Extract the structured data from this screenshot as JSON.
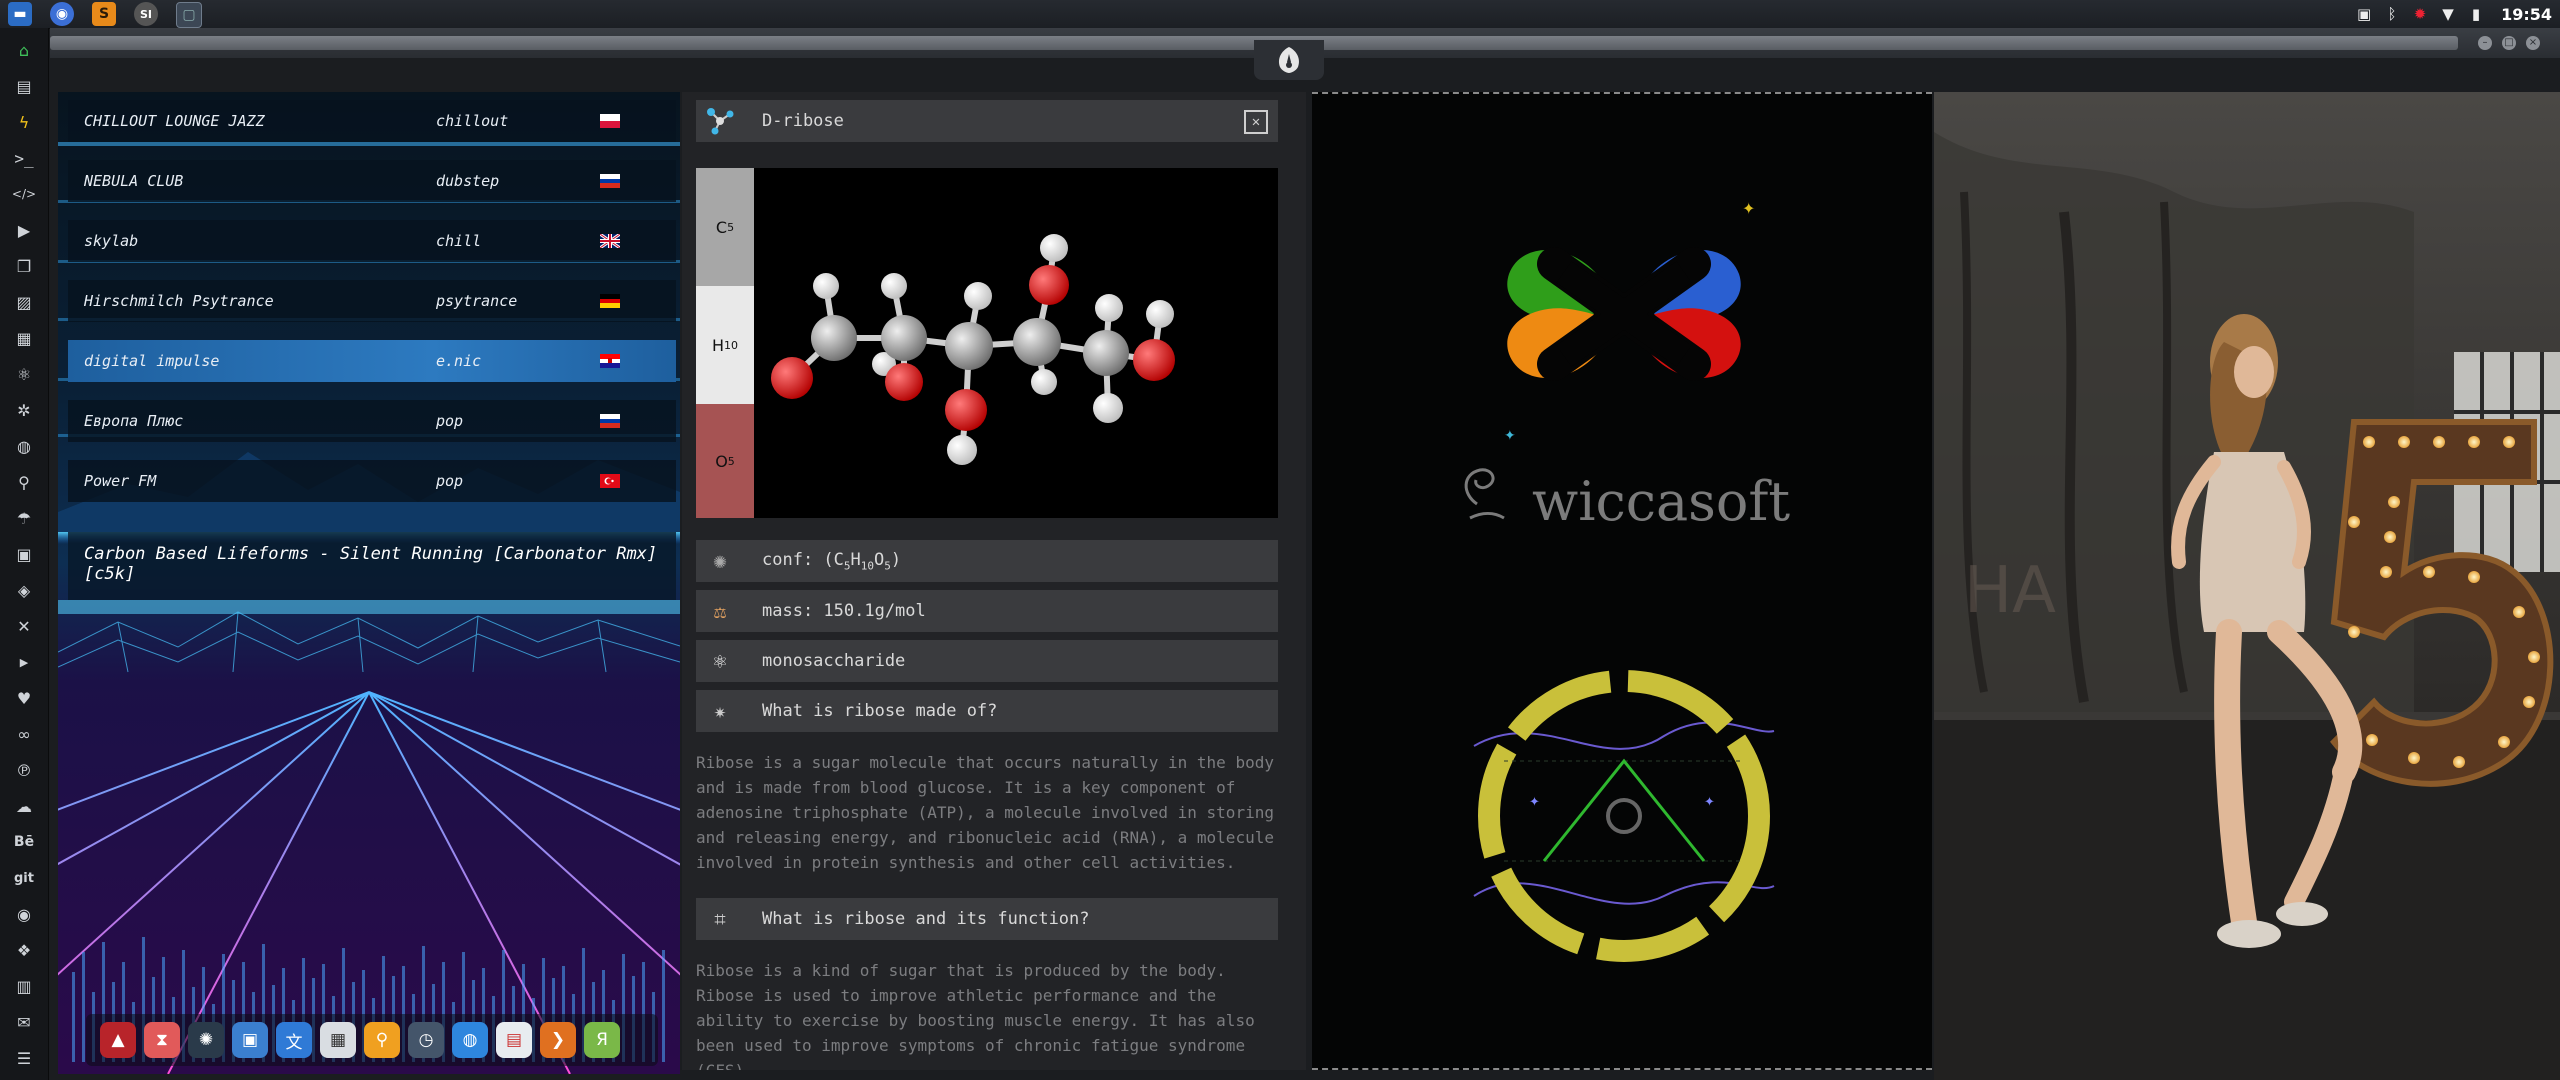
{
  "clock": "19:54",
  "radio": {
    "stations": [
      {
        "name": "CHILLOUT LOUNGE JAZZ",
        "genre": "chillout",
        "flag": "pl"
      },
      {
        "name": "NEBULA CLUB",
        "genre": "dubstep",
        "flag": "ru"
      },
      {
        "name": "skylab",
        "genre": "chill",
        "flag": "gb"
      },
      {
        "name": "Hirschmilch Psytrance",
        "genre": "psytrance",
        "flag": "de"
      },
      {
        "name": "digital impulse",
        "genre": "e.nic",
        "flag": "hr"
      },
      {
        "name": "Европа Плюс",
        "genre": "pop",
        "flag": "ru"
      },
      {
        "name": "Power FM",
        "genre": "pop",
        "flag": "tr"
      }
    ],
    "active_index": 4,
    "now_playing": "Carbon Based Lifeforms - Silent Running [Carbonator Rmx] [c5k]"
  },
  "chem": {
    "title": "D-ribose",
    "composition": [
      {
        "el": "C",
        "n": "5",
        "color": "#a7a7a7"
      },
      {
        "el": "H",
        "n": "10",
        "color": "#e9e9e9"
      },
      {
        "el": "O",
        "n": "5",
        "color": "#a65353"
      }
    ],
    "conf_prefix": "conf: (",
    "conf_c": "C",
    "conf_c_n": "5",
    "conf_h": "H",
    "conf_h_n": "10",
    "conf_o": "O",
    "conf_o_n": "5",
    "conf_suffix": ")",
    "mass": "mass: 150.1g/mol",
    "class": "monosaccharide",
    "q1": "What is ribose made of?",
    "a1": "Ribose is a sugar molecule that occurs naturally in the body and is made from blood glucose. It is a key component of adenosine triphosphate (ATP), a molecule involved in storing and releasing energy, and ribonucleic acid (RNA), a molecule involved in protein synthesis and other cell activities.",
    "q2": "What is ribose and its function?",
    "a2": "Ribose is a kind of sugar that is produced by the body. Ribose is used to improve athletic performance and the ability to exercise by boosting muscle energy. It has also been used to improve symptoms of chronic fatigue syndrome (CFS),"
  },
  "wicca": {
    "name": "wiccasoft",
    "colors": {
      "green": "#2f9e1a",
      "blue": "#2a5fd1",
      "orange": "#ee8a12",
      "red": "#d4110f",
      "ring": "#c9c03a"
    }
  },
  "photo": {
    "number": "5"
  }
}
